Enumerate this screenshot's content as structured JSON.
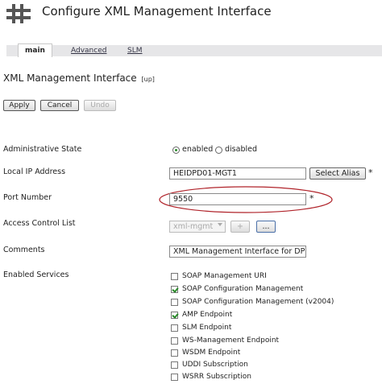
{
  "header": {
    "title": "Configure XML Management Interface"
  },
  "tabs": [
    {
      "label": "main",
      "active": true
    },
    {
      "label": "Advanced",
      "active": false
    },
    {
      "label": "SLM",
      "active": false
    }
  ],
  "section": {
    "title": "XML Management Interface",
    "status": "[up]"
  },
  "toolbar": {
    "apply": "Apply",
    "cancel": "Cancel",
    "undo": "Undo"
  },
  "form": {
    "admin_state": {
      "label": "Administrative State",
      "options": [
        "enabled",
        "disabled"
      ],
      "selected": "enabled"
    },
    "local_ip": {
      "label": "Local IP Address",
      "value": "HEIDPD01-MGT1",
      "button": "Select Alias",
      "required": "*"
    },
    "port": {
      "label": "Port Number",
      "value": "9550",
      "required": "*"
    },
    "acl": {
      "label": "Access Control List",
      "value": "xml-mgmt",
      "add": "+",
      "more": "..."
    },
    "comments": {
      "label": "Comments",
      "value": "XML Management Interface for DPI"
    },
    "services": {
      "label": "Enabled Services",
      "items": [
        {
          "label": "SOAP Management URI",
          "checked": false
        },
        {
          "label": "SOAP Configuration Management",
          "checked": true
        },
        {
          "label": "SOAP Configuration Management (v2004)",
          "checked": false
        },
        {
          "label": "AMP Endpoint",
          "checked": true
        },
        {
          "label": "SLM Endpoint",
          "checked": false
        },
        {
          "label": "WS-Management Endpoint",
          "checked": false
        },
        {
          "label": "WSDM Endpoint",
          "checked": false
        },
        {
          "label": "UDDI Subscription",
          "checked": false
        },
        {
          "label": "WSRR Subscription",
          "checked": false
        }
      ]
    }
  },
  "colors": {
    "accent": "#2a8a2a",
    "highlight_ellipse": "#b0232a",
    "tabbar": "#e6e6e8"
  },
  "icons": {
    "logo": "datapower-grid-icon"
  }
}
